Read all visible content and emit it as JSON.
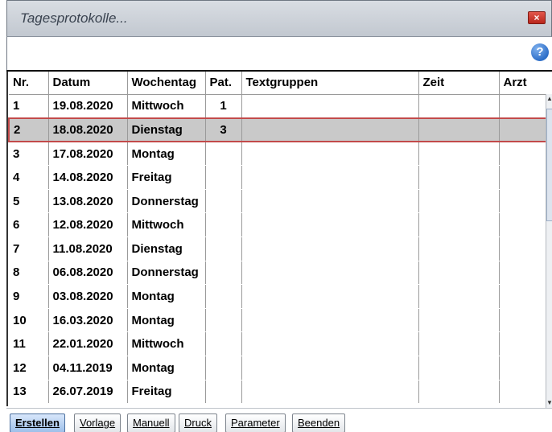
{
  "window": {
    "title": "Tagesprotokolle...",
    "close_label": "×",
    "help_label": "?"
  },
  "table": {
    "headers": [
      "Nr.",
      "Datum",
      "Wochentag",
      "Pat.",
      "Textgruppen",
      "Zeit",
      "Arzt"
    ],
    "rows": [
      [
        "1",
        "19.08.2020",
        "Mittwoch",
        "1",
        "",
        "",
        ""
      ],
      [
        "2",
        "18.08.2020",
        "Dienstag",
        "3",
        "",
        "",
        ""
      ],
      [
        "3",
        "17.08.2020",
        "Montag",
        "",
        "",
        "",
        ""
      ],
      [
        "4",
        "14.08.2020",
        "Freitag",
        "",
        "",
        "",
        ""
      ],
      [
        "5",
        "13.08.2020",
        "Donnerstag",
        "",
        "",
        "",
        ""
      ],
      [
        "6",
        "12.08.2020",
        "Mittwoch",
        "",
        "",
        "",
        ""
      ],
      [
        "7",
        "11.08.2020",
        "Dienstag",
        "",
        "",
        "",
        ""
      ],
      [
        "8",
        "06.08.2020",
        "Donnerstag",
        "",
        "",
        "",
        ""
      ],
      [
        "9",
        "03.08.2020",
        "Montag",
        "",
        "",
        "",
        ""
      ],
      [
        "10",
        "16.03.2020",
        "Montag",
        "",
        "",
        "",
        ""
      ],
      [
        "11",
        "22.01.2020",
        "Mittwoch",
        "",
        "",
        "",
        ""
      ],
      [
        "12",
        "04.11.2019",
        "Montag",
        "",
        "",
        "",
        ""
      ],
      [
        "13",
        "26.07.2019",
        "Freitag",
        "",
        "",
        "",
        ""
      ]
    ],
    "selected_row": 2
  },
  "buttons": [
    "Erstellen",
    "Vorlage",
    "Manuell",
    "Druck",
    "Parameter",
    "Beenden"
  ],
  "colors": {
    "selection_border": "#c24a4a",
    "selection_fill": "#c9c9c9",
    "primary_button": "#9ec0ea"
  }
}
